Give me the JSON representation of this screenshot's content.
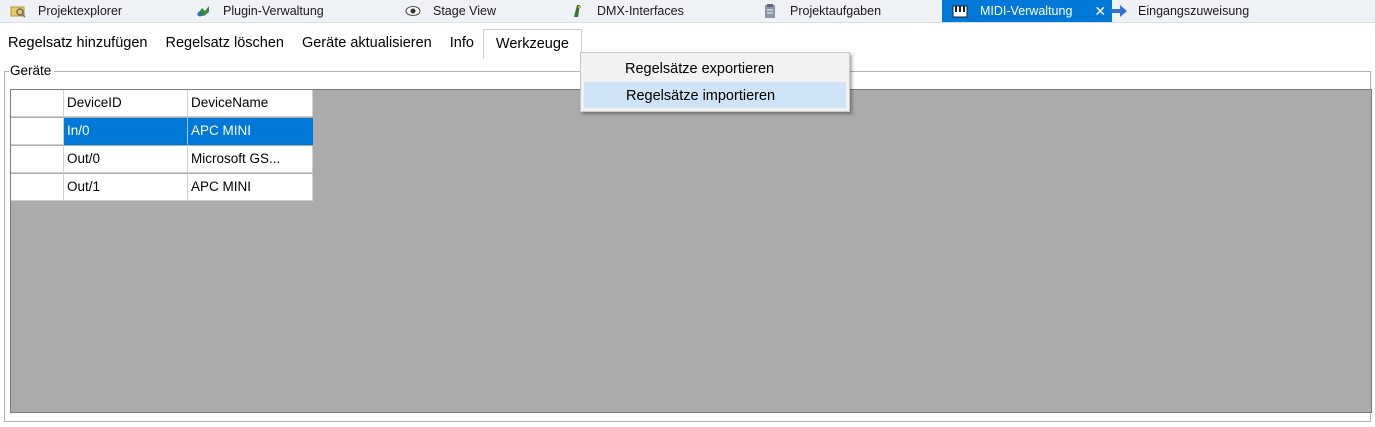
{
  "tabs": [
    {
      "label": "Projektexplorer",
      "icon": "project-explorer-icon"
    },
    {
      "label": "Plugin-Verwaltung",
      "icon": "plugin-icon"
    },
    {
      "label": "Stage View",
      "icon": "eye-icon"
    },
    {
      "label": "DMX-Interfaces",
      "icon": "dmx-interface-icon"
    },
    {
      "label": "Projektaufgaben",
      "icon": "tasks-icon"
    },
    {
      "label": "MIDI-Verwaltung",
      "icon": "midi-keyboard-icon",
      "active": true,
      "close": "✕"
    },
    {
      "label": "Eingangszuweisung",
      "icon": "arrow-right-icon"
    }
  ],
  "menu": {
    "add_ruleset": "Regelsatz hinzufügen",
    "delete_ruleset": "Regelsatz löschen",
    "refresh_devices": "Geräte aktualisieren",
    "info": "Info",
    "tools": "Werkzeuge"
  },
  "tools_menu": {
    "export": "Regelsätze exportieren",
    "import": "Regelsätze importieren"
  },
  "devices": {
    "group_title": "Geräte",
    "columns": [
      "DeviceID",
      "DeviceName"
    ],
    "rows": [
      {
        "id": "In/0",
        "name": "APC MINI",
        "selected": true
      },
      {
        "id": "Out/0",
        "name": "Microsoft GS..."
      },
      {
        "id": "Out/1",
        "name": "APC MINI"
      }
    ]
  },
  "colors": {
    "accent": "#0078d7",
    "grid_background": "#ababab",
    "menu_hover": "#cfe3f7"
  }
}
